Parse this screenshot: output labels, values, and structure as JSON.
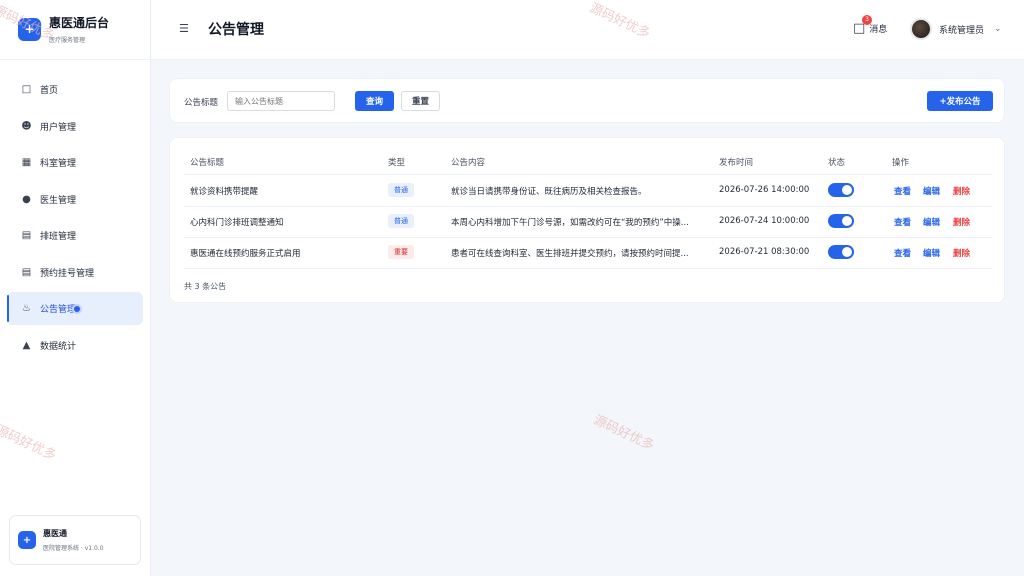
{
  "sidebar": {
    "brand_title": "惠医通后台",
    "brand_sub": "医疗服务管理",
    "items": [
      {
        "label": "首页",
        "icon": "monitor-icon"
      },
      {
        "label": "用户管理",
        "icon": "user-icon"
      },
      {
        "label": "科室管理",
        "icon": "building-icon"
      },
      {
        "label": "医生管理",
        "icon": "doctor-icon"
      },
      {
        "label": "排班管理",
        "icon": "calendar-icon"
      },
      {
        "label": "预约挂号管理",
        "icon": "document-icon"
      },
      {
        "label": "公告管理",
        "icon": "bell-icon",
        "active": true
      },
      {
        "label": "数据统计",
        "icon": "chart-icon"
      }
    ],
    "footer_title": "惠医通",
    "footer_sub": "医院管理系统 · v1.0.0"
  },
  "header": {
    "title": "公告管理",
    "message_label": "消息",
    "message_count": "3",
    "user_name": "系统管理员"
  },
  "filter": {
    "label": "公告标题",
    "placeholder": "输入公告标题",
    "query_label": "查询",
    "reset_label": "重置",
    "add_label": "+发布公告"
  },
  "table": {
    "columns": [
      "公告标题",
      "类型",
      "公告内容",
      "发布时间",
      "状态",
      "操作"
    ],
    "rows": [
      {
        "title": "就诊资料携带提醒",
        "type": "普通",
        "type_kind": "normal",
        "content": "就诊当日请携带身份证、既往病历及相关检查报告。",
        "time": "2026-07-26 14:00:00",
        "enabled": true
      },
      {
        "title": "心内科门诊排班调整通知",
        "type": "普通",
        "type_kind": "normal",
        "content": "本周心内科增加下午门诊号源，如需改约可在“我的预约”中操...",
        "time": "2026-07-24 10:00:00",
        "enabled": true
      },
      {
        "title": "惠医通在线预约服务正式启用",
        "type": "重要",
        "type_kind": "important",
        "content": "患者可在线查询科室、医生排班并提交预约，请按预约时间提...",
        "time": "2026-07-21 08:30:00",
        "enabled": true
      }
    ],
    "actions": {
      "view": "查看",
      "edit": "编辑",
      "delete": "删除"
    },
    "total_text": "共 3 条公告"
  },
  "watermark": "源码好优多"
}
